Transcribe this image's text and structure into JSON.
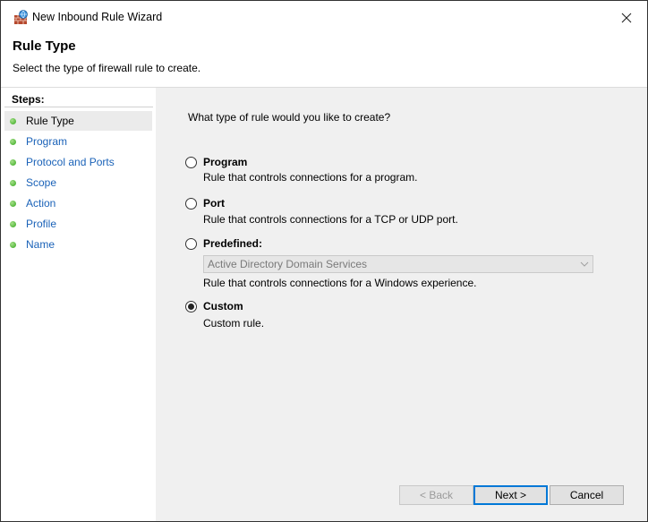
{
  "window": {
    "title": "New Inbound Rule Wizard"
  },
  "header": {
    "title": "Rule Type",
    "subtitle": "Select the type of firewall rule to create."
  },
  "sidebar": {
    "heading": "Steps:",
    "items": [
      {
        "label": "Rule Type",
        "active": true
      },
      {
        "label": "Program"
      },
      {
        "label": "Protocol and Ports"
      },
      {
        "label": "Scope"
      },
      {
        "label": "Action"
      },
      {
        "label": "Profile"
      },
      {
        "label": "Name"
      }
    ]
  },
  "main": {
    "question": "What type of rule would you like to create?",
    "options": [
      {
        "label": "Program",
        "description": "Rule that controls connections for a program.",
        "selected": false
      },
      {
        "label": "Port",
        "description": "Rule that controls connections for a TCP or UDP port.",
        "selected": false
      },
      {
        "label": "Predefined:",
        "description": "Rule that controls connections for a Windows experience.",
        "selected": false
      },
      {
        "label": "Custom",
        "description": "Custom rule.",
        "selected": true
      }
    ],
    "predefined_select": {
      "value": "Active Directory Domain Services",
      "enabled": false
    }
  },
  "buttons": {
    "back": "< Back",
    "next": "Next >",
    "cancel": "Cancel"
  },
  "colors": {
    "accent": "#0078d7",
    "link": "#1a62b8",
    "step_dot": "#35a81e",
    "panel_bg": "#f0f0f0"
  }
}
